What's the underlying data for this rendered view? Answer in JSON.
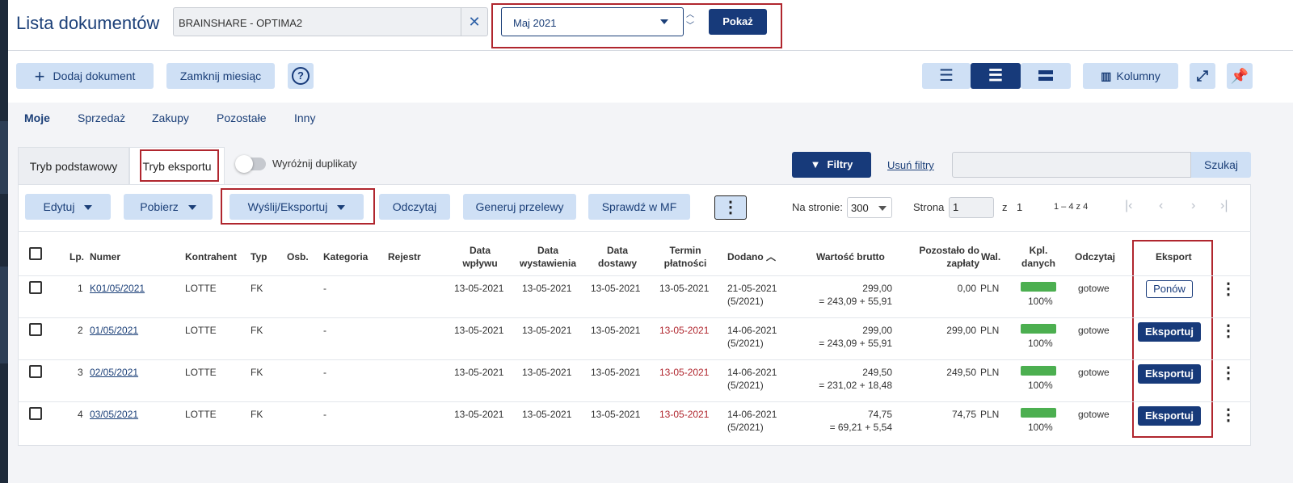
{
  "header": {
    "title": "Lista dokumentów",
    "company": "BRAINSHARE - OPTIMA2",
    "month": "Maj 2021",
    "show_label": "Pokaż"
  },
  "toolbar": {
    "add_label": "Dodaj dokument",
    "close_month_label": "Zamknij miesiąc",
    "columns_label": "Kolumny"
  },
  "tabs": [
    "Moje",
    "Sprzedaż",
    "Zakupy",
    "Pozostałe",
    "Inny"
  ],
  "modes": {
    "basic": "Tryb podstawowy",
    "export": "Tryb eksportu",
    "duplicates": "Wyróżnij duplikaty"
  },
  "filters": {
    "filter_label": "Filtry",
    "clear_label": "Usuń filtry",
    "search_label": "Szukaj"
  },
  "actions": {
    "edit": "Edytuj",
    "download": "Pobierz",
    "send": "Wyślij/Eksportuj",
    "read": "Odczytaj",
    "transfers": "Generuj przelewy",
    "check_mf": "Sprawdź w MF"
  },
  "paging": {
    "per_page_label": "Na stronie:",
    "per_page": "300",
    "page_label": "Strona",
    "page": "1",
    "of_label": "z",
    "total_pages": "1",
    "range": "1 – 4 z 4"
  },
  "columns": {
    "lp": "Lp.",
    "number": "Numer",
    "contractor": "Kontrahent",
    "type": "Typ",
    "person": "Osb.",
    "category": "Kategoria",
    "register": "Rejestr",
    "receipt_date": "Data\nwpływu",
    "issue_date": "Data\nwystawienia",
    "delivery_date": "Data\ndostawy",
    "due_date": "Termin\npłatności",
    "added": "Dodano",
    "gross": "Wartość brutto",
    "remaining": "Pozostało do\nzapłaty",
    "currency": "Wal.",
    "completeness": "Kpl.\ndanych",
    "read": "Odczytaj",
    "export": "Eksport"
  },
  "rows": [
    {
      "lp": "1",
      "number": "K01/05/2021",
      "contractor": "LOTTE",
      "type": "FK",
      "category": "-",
      "receipt": "13-05-2021",
      "issue": "13-05-2021",
      "delivery": "13-05-2021",
      "due": "13-05-2021",
      "due_overdue": false,
      "added": "21-05-2021",
      "added_period": "(5/2021)",
      "gross": "299,00",
      "gross_split": "= 243,09 + 55,91",
      "remaining": "0,00",
      "currency": "PLN",
      "completeness": "100%",
      "completeness_value": 1.0,
      "read": "gotowe",
      "export": "Ponów"
    },
    {
      "lp": "2",
      "number": "01/05/2021",
      "contractor": "LOTTE",
      "type": "FK",
      "category": "-",
      "receipt": "13-05-2021",
      "issue": "13-05-2021",
      "delivery": "13-05-2021",
      "due": "13-05-2021",
      "due_overdue": true,
      "added": "14-06-2021",
      "added_period": "(5/2021)",
      "gross": "299,00",
      "gross_split": "= 243,09 + 55,91",
      "remaining": "299,00",
      "currency": "PLN",
      "completeness": "100%",
      "completeness_value": 1.0,
      "read": "gotowe",
      "export": "Eksportuj"
    },
    {
      "lp": "3",
      "number": "02/05/2021",
      "contractor": "LOTTE",
      "type": "FK",
      "category": "-",
      "receipt": "13-05-2021",
      "issue": "13-05-2021",
      "delivery": "13-05-2021",
      "due": "13-05-2021",
      "due_overdue": true,
      "added": "14-06-2021",
      "added_period": "(5/2021)",
      "gross": "249,50",
      "gross_split": "= 231,02 + 18,48",
      "remaining": "249,50",
      "currency": "PLN",
      "completeness": "100%",
      "completeness_value": 1.0,
      "read": "gotowe",
      "export": "Eksportuj"
    },
    {
      "lp": "4",
      "number": "03/05/2021",
      "contractor": "LOTTE",
      "type": "FK",
      "category": "-",
      "receipt": "13-05-2021",
      "issue": "13-05-2021",
      "delivery": "13-05-2021",
      "due": "13-05-2021",
      "due_overdue": true,
      "added": "14-06-2021",
      "added_period": "(5/2021)",
      "gross": "74,75",
      "gross_split": "= 69,21 + 5,54",
      "remaining": "74,75",
      "currency": "PLN",
      "completeness": "100%",
      "completeness_value": 1.0,
      "read": "gotowe",
      "export": "Eksportuj"
    }
  ]
}
